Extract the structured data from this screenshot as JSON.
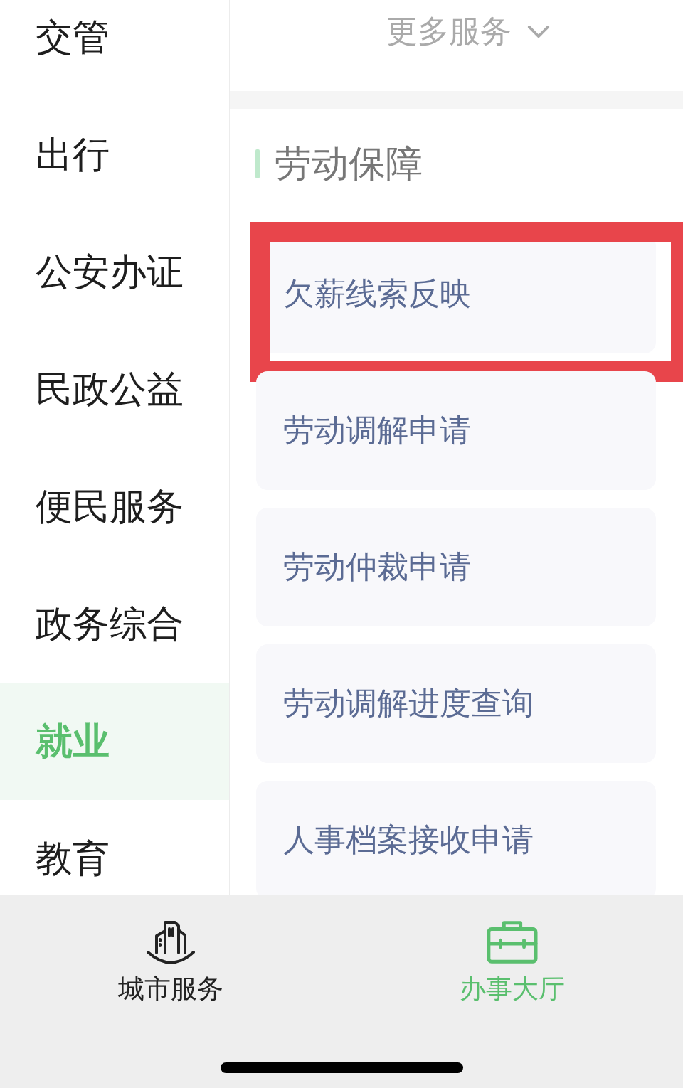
{
  "sidebar": {
    "items": [
      {
        "label": "交管",
        "selected": false
      },
      {
        "label": "出行",
        "selected": false
      },
      {
        "label": "公安办证",
        "selected": false
      },
      {
        "label": "民政公益",
        "selected": false
      },
      {
        "label": "便民服务",
        "selected": false
      },
      {
        "label": "政务综合",
        "selected": false
      },
      {
        "label": "就业",
        "selected": true
      },
      {
        "label": "教育",
        "selected": false
      }
    ]
  },
  "header": {
    "title": "更多服务"
  },
  "section": {
    "title": "劳动保障",
    "items": [
      {
        "label": "欠薪线索反映",
        "highlighted": true
      },
      {
        "label": "劳动调解申请",
        "highlighted": false
      },
      {
        "label": "劳动仲裁申请",
        "highlighted": false
      },
      {
        "label": "劳动调解进度查询",
        "highlighted": false
      },
      {
        "label": "人事档案接收申请",
        "highlighted": false
      }
    ]
  },
  "tab_bar": {
    "items": [
      {
        "kind": "city",
        "label": "城市服务",
        "selected": false
      },
      {
        "kind": "hall",
        "label": "办事大厅",
        "selected": true
      }
    ]
  }
}
